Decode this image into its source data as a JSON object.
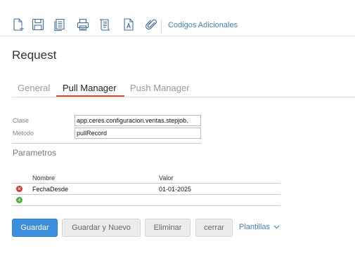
{
  "toolbar": {
    "icons": [
      "new-document-icon",
      "save-icon",
      "copy-icon",
      "print-icon",
      "script-icon",
      "text-document-icon",
      "attachment-icon"
    ],
    "link_label": "Codigos Adicionales",
    "accent": "#3a82c8"
  },
  "page": {
    "title": "Request"
  },
  "tabs": [
    {
      "label": "General",
      "active": false
    },
    {
      "label": "Pull Manager",
      "active": true
    },
    {
      "label": "Push Manager",
      "active": false
    }
  ],
  "form": {
    "clase_label": "Clase",
    "clase_value": "app.ceres.configuracion.ventas.stepjob.",
    "metodo_label": "Metodo",
    "metodo_value": "pullRecord"
  },
  "parametros": {
    "title": "Parametros",
    "columns": [
      "Nombre",
      "Valor"
    ],
    "rows": [
      {
        "nombre": "FechaDesde",
        "valor": "01-01-2025"
      }
    ]
  },
  "buttons": {
    "guardar": "Guardar",
    "guardar_nuevo": "Guardar y Nuevo",
    "eliminar": "Eliminar",
    "cerrar": "cerrar",
    "plantillas": "Plantillas"
  },
  "colors": {
    "primary_button": "#3b8fdd",
    "active_tab_underline": "#d9472b",
    "delete_icon": "#d9342b",
    "add_icon": "#4caf3c"
  }
}
